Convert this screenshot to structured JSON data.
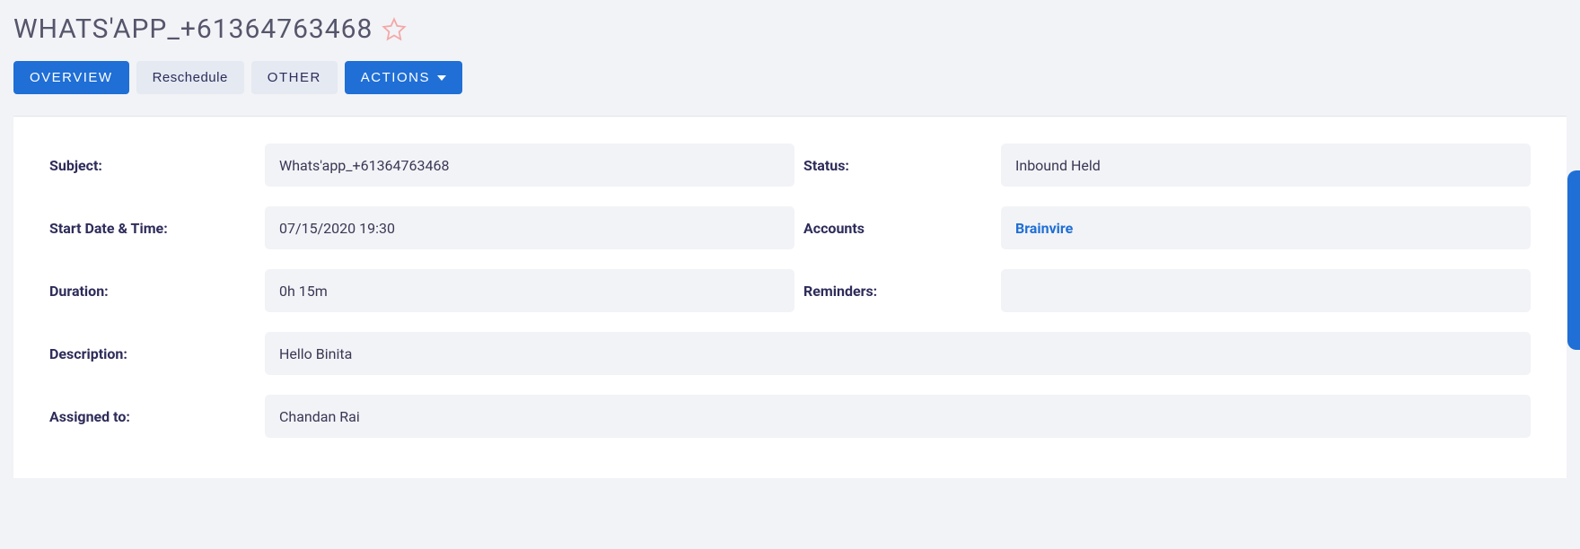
{
  "header": {
    "title": "WHATS'APP_+61364763468"
  },
  "tabs": {
    "overview": "OVERVIEW",
    "reschedule": "Reschedule",
    "other": "OTHER",
    "actions": "ACTIONS"
  },
  "labels": {
    "subject": "Subject:",
    "status": "Status:",
    "start": "Start Date & Time:",
    "accounts": "Accounts",
    "duration": "Duration:",
    "reminders": "Reminders:",
    "description": "Description:",
    "assigned": "Assigned to:"
  },
  "values": {
    "subject": "Whats'app_+61364763468",
    "status": "Inbound Held",
    "start": "07/15/2020 19:30",
    "accounts": "Brainvire",
    "duration": "0h 15m",
    "reminders": "",
    "description": "Hello Binita",
    "assigned": "Chandan Rai"
  }
}
